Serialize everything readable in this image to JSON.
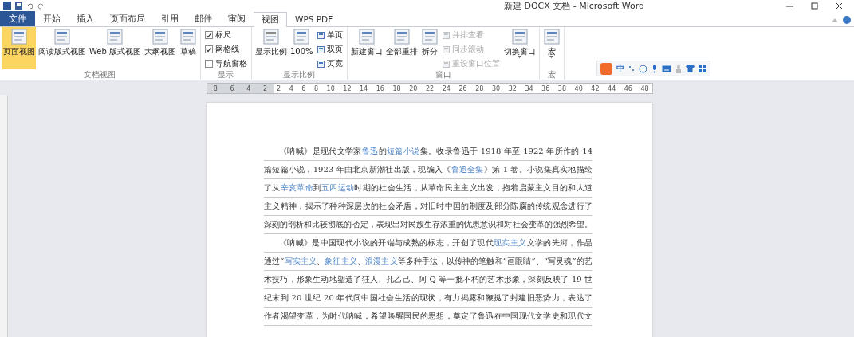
{
  "window": {
    "title": "新建 DOCX 文档 - Microsoft Word"
  },
  "tabs": [
    {
      "label": "文件",
      "kind": "file",
      "selected": false
    },
    {
      "label": "开始",
      "kind": "tab",
      "selected": false
    },
    {
      "label": "插入",
      "kind": "tab",
      "selected": false
    },
    {
      "label": "页面布局",
      "kind": "tab",
      "selected": false
    },
    {
      "label": "引用",
      "kind": "tab",
      "selected": false
    },
    {
      "label": "邮件",
      "kind": "tab",
      "selected": false
    },
    {
      "label": "审阅",
      "kind": "tab",
      "selected": false
    },
    {
      "label": "视图",
      "kind": "tab",
      "selected": true
    },
    {
      "label": "WPS PDF",
      "kind": "tab",
      "selected": false
    }
  ],
  "ribbon": [
    {
      "label": "文档视图",
      "items": [
        {
          "kind": "large",
          "label": "页面视图",
          "selected": true,
          "menu": false
        },
        {
          "kind": "large",
          "label": "阅读版式视图",
          "selected": false,
          "menu": false
        },
        {
          "kind": "large",
          "label": "Web 版式视图",
          "selected": false,
          "menu": false
        },
        {
          "kind": "large",
          "label": "大纲视图",
          "selected": false,
          "menu": false
        },
        {
          "kind": "large",
          "label": "草稿",
          "selected": false,
          "menu": false
        }
      ]
    },
    {
      "label": "显示",
      "items": [
        {
          "kind": "stack",
          "entries": [
            {
              "kind": "check",
              "label": "标尺",
              "checked": true
            },
            {
              "kind": "check",
              "label": "网格线",
              "checked": true
            },
            {
              "kind": "check",
              "label": "导航窗格",
              "checked": false
            }
          ]
        }
      ]
    },
    {
      "label": "显示比例",
      "items": [
        {
          "kind": "large",
          "label": "显示比例",
          "selected": false,
          "menu": false
        },
        {
          "kind": "large",
          "label": "100%",
          "selected": false,
          "menu": false
        },
        {
          "kind": "stack",
          "entries": [
            {
              "kind": "small",
              "label": "单页",
              "disabled": false
            },
            {
              "kind": "small",
              "label": "双页",
              "disabled": false
            },
            {
              "kind": "small",
              "label": "页宽",
              "disabled": false
            }
          ]
        }
      ]
    },
    {
      "label": "窗口",
      "items": [
        {
          "kind": "large",
          "label": "新建窗口",
          "selected": false,
          "menu": false
        },
        {
          "kind": "large",
          "label": "全部重排",
          "selected": false,
          "menu": false
        },
        {
          "kind": "large",
          "label": "拆分",
          "selected": false,
          "menu": false
        },
        {
          "kind": "stack",
          "entries": [
            {
              "kind": "small",
              "label": "并排查看",
              "disabled": true
            },
            {
              "kind": "small",
              "label": "同步滚动",
              "disabled": true
            },
            {
              "kind": "small",
              "label": "重设窗口位置",
              "disabled": true
            }
          ]
        },
        {
          "kind": "large",
          "label": "切换窗口",
          "selected": false,
          "menu": true
        }
      ]
    },
    {
      "label": "宏",
      "items": [
        {
          "kind": "large",
          "label": "宏",
          "selected": false,
          "menu": true
        }
      ]
    }
  ],
  "ime_toolbar": {
    "mode": "中"
  },
  "ruler": {
    "left_numbers": [
      "8",
      "6",
      "4",
      "2"
    ],
    "right_numbers": [
      "2",
      "4",
      "6",
      "8",
      "10",
      "12",
      "14",
      "16",
      "18",
      "20",
      "22",
      "24",
      "26",
      "28",
      "30",
      "32",
      "34",
      "36",
      "38",
      "40",
      "42",
      "44",
      "46",
      "48"
    ]
  },
  "document": {
    "paragraphs": [
      {
        "lines": [
          [
            {
              "kind": "text",
              "text": "《呐喊》是现代文学家"
            },
            {
              "kind": "link",
              "text": "鲁迅"
            },
            {
              "kind": "text",
              "text": "的"
            },
            {
              "kind": "link",
              "text": "短篇小说"
            },
            {
              "kind": "text",
              "text": "集。收录鲁迅于 1918 年至 1922 年所作的 14"
            }
          ],
          [
            {
              "kind": "text",
              "text": "篇短篇小说，1923 年由北京新潮社出版，现编入《"
            },
            {
              "kind": "link",
              "text": "鲁迅全集"
            },
            {
              "kind": "text",
              "text": "》第 1 卷。小说集真实地描绘"
            }
          ],
          [
            {
              "kind": "text",
              "text": "了从"
            },
            {
              "kind": "link",
              "text": "辛亥革命"
            },
            {
              "kind": "text",
              "text": "到"
            },
            {
              "kind": "link",
              "text": "五四运动"
            },
            {
              "kind": "text",
              "text": "时期的社会生活，从革命民主主义出发，抱着启蒙主义目的和人道"
            }
          ],
          [
            {
              "kind": "text",
              "text": "主义精神，揭示了种种深层次的社会矛盾，对旧时中国的制度及部分陈腐的传统观念进行了"
            }
          ],
          [
            {
              "kind": "text",
              "text": "深刻的剖析和比较彻底的否定，表现出对民族生存浓重的忧患意识和对社会变革的强烈希望。"
            }
          ]
        ]
      },
      {
        "lines": [
          [
            {
              "kind": "text",
              "text": "《呐喊》是中国现代小说的开端与成熟的标志，开创了现代"
            },
            {
              "kind": "link",
              "text": "现实主义"
            },
            {
              "kind": "text",
              "text": "文学的先河，作品"
            }
          ],
          [
            {
              "kind": "text",
              "text": "通过“"
            },
            {
              "kind": "link",
              "text": "写实主义"
            },
            {
              "kind": "text",
              "text": "、"
            },
            {
              "kind": "link",
              "text": "象征主义"
            },
            {
              "kind": "text",
              "text": "、"
            },
            {
              "kind": "link",
              "text": "浪漫主义"
            },
            {
              "kind": "text",
              "text": "等多种手法，以传神的笔触和“画眼睛”、“写灵魂”的艺"
            }
          ],
          [
            {
              "kind": "text",
              "text": "术技巧，形象生动地塑造了狂人、孔乙己、阿 Q 等一批不朽的艺术形象，深刻反映了 19 世"
            }
          ],
          [
            {
              "kind": "text",
              "text": "纪末到 20 世纪 20 年代间中国社会生活的现状，有力揭露和鞭挞了封建旧恶势力，表达了"
            }
          ],
          [
            {
              "kind": "text",
              "text": "作者渴望变革，为时代呐喊，希望唤醒国民的思想，奠定了鲁迅在中国现代文学史和现代文"
            }
          ]
        ]
      }
    ]
  }
}
